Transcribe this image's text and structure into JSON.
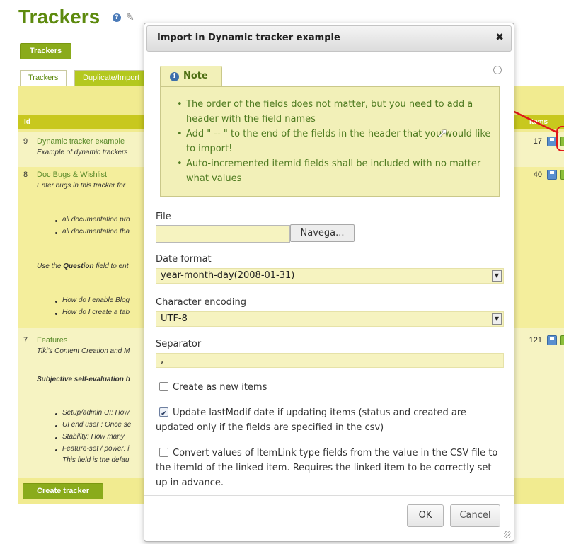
{
  "page": {
    "title": "Trackers",
    "trackers_button": "Trackers",
    "tabs": [
      "Trackers",
      "Duplicate/Import"
    ],
    "table_headers": {
      "id": "Id",
      "items": "Items"
    },
    "rows": [
      {
        "id": "9",
        "name": "Dynamic tracker example",
        "desc": "Example of dynamic trackers",
        "count": "17"
      },
      {
        "id": "8",
        "name": "Doc Bugs & Wishlist",
        "desc": "Enter bugs in this tracker for",
        "count": "40",
        "bullets1": [
          "all documentation pro",
          "all documentation tha"
        ],
        "question_pre": "Use the ",
        "question_word": "Question",
        "question_post": " field to ent",
        "bullets2": [
          "How do I enable Blog",
          "How do I create a tab"
        ]
      },
      {
        "id": "7",
        "name": "Features",
        "desc": "Tiki's Content Creation and M",
        "count": "121",
        "subtitle": "Subjective self-evaluation b",
        "bullets": [
          "Setup/admin UI: How",
          "UI end user : Once se",
          "Stability: How many ",
          "Feature-set / power: i"
        ],
        "extra": "This field is the defau"
      }
    ],
    "create_button": "Create tracker"
  },
  "dialog": {
    "title": "Import in Dynamic tracker example",
    "close": "✖",
    "note_label": "Note",
    "note_items": [
      "The order of the fields does not matter, but you need to add a header with the field names",
      "Add \" -- \" to the end of the fields in the header that you would like to import!",
      "Auto-incremented itemid fields shall be included with no matter what values"
    ],
    "file_label": "File",
    "file_value": "",
    "browse_button": "Navega...",
    "date_format_label": "Date format",
    "date_format_value": "year-month-day(2008-01-31)",
    "encoding_label": "Character encoding",
    "encoding_value": "UTF-8",
    "separator_label": "Separator",
    "separator_value": ",",
    "checkboxes": [
      {
        "label": "Create as new items",
        "checked": false
      },
      {
        "label": "Update lastModif date if updating items (status and created are updated only if the fields are specified in the csv)",
        "checked": true
      },
      {
        "label": "Convert values of ItemLink type fields from the value in the CSV file to the itemId of the linked item. Requires the linked item to be correctly set up in advance.",
        "checked": false
      }
    ],
    "ok_button": "OK",
    "cancel_button": "Cancel"
  },
  "colors": {
    "brand_green": "#5d8a0e",
    "button_green": "#8aab1b",
    "panel_yellow": "#f1eb90",
    "annotation_red": "#e0161a"
  }
}
